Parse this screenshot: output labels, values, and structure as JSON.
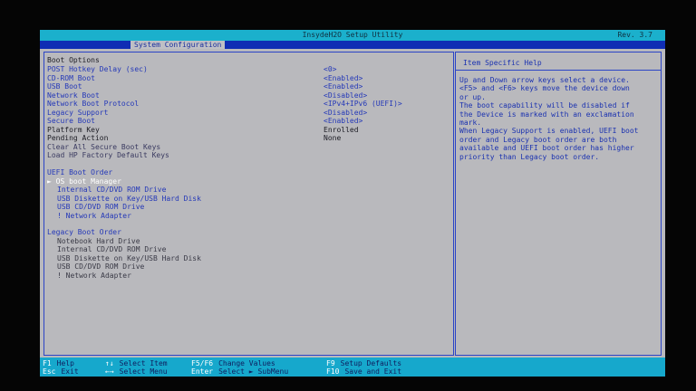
{
  "titlebar": {
    "title": "InsydeH2O Setup Utility",
    "rev": "Rev. 3.7"
  },
  "tab": "System Configuration",
  "settings": [
    {
      "label": "Boot Options",
      "value": "",
      "kind": "section"
    },
    {
      "label": "POST Hotkey Delay (sec)",
      "value": "<0>",
      "kind": "option"
    },
    {
      "label": "CD-ROM Boot",
      "value": "<Enabled>",
      "kind": "option"
    },
    {
      "label": "USB Boot",
      "value": "<Enabled>",
      "kind": "option"
    },
    {
      "label": "Network Boot",
      "value": "<Disabled>",
      "kind": "option"
    },
    {
      "label": "Network Boot Protocol",
      "value": "<IPv4+IPv6 (UEFI)>",
      "kind": "option"
    },
    {
      "label": "Legacy Support",
      "value": "<Disabled>",
      "kind": "option"
    },
    {
      "label": "Secure Boot",
      "value": "<Enabled>",
      "kind": "option"
    },
    {
      "label": "Platform Key",
      "value": "Enrolled",
      "kind": "fixed"
    },
    {
      "label": "Pending Action",
      "value": "None",
      "kind": "fixed"
    },
    {
      "label": "Clear All Secure Boot Keys",
      "value": "",
      "kind": "action"
    },
    {
      "label": "Load HP Factory Default Keys",
      "value": "",
      "kind": "action"
    }
  ],
  "uefi_order": {
    "heading": "UEFI Boot Order",
    "items": [
      "► OS boot Manager",
      "Internal CD/DVD ROM Drive",
      "USB Diskette on Key/USB Hard Disk",
      "USB CD/DVD ROM Drive",
      "! Network Adapter"
    ]
  },
  "legacy_order": {
    "heading": "Legacy Boot Order",
    "items": [
      "Notebook Hard Drive",
      "Internal CD/DVD ROM Drive",
      "USB Diskette on Key/USB Hard Disk",
      "USB CD/DVD ROM Drive",
      "! Network Adapter"
    ]
  },
  "help": {
    "title": "Item Specific Help",
    "lines": [
      "Up and Down arrow keys select a device.",
      "<F5> and <F6> keys move the device down",
      "or up.",
      "The boot capability will be disabled if",
      "the Device is marked with an exclamation",
      "mark.",
      "When Legacy Support is enabled, UEFI boot",
      "order and Legacy boot order are both",
      "available and UEFI boot order has higher",
      "priority than Legacy boot order."
    ]
  },
  "footer": [
    {
      "key": "F1",
      "desc": "Help"
    },
    {
      "key": "Esc",
      "desc": "Exit"
    },
    {
      "key": "↑↓",
      "desc": "Select Item"
    },
    {
      "key": "←→",
      "desc": "Select Menu"
    },
    {
      "key": "F5/F6",
      "desc": "Change Values"
    },
    {
      "key": "Enter",
      "desc": "Select ► SubMenu"
    },
    {
      "key": "F9",
      "desc": "Setup Defaults"
    },
    {
      "key": "F10",
      "desc": "Save and Exit"
    }
  ],
  "colors": {
    "title_bar": "#1bb0cc",
    "tab_bar": "#0f2db4",
    "panel_bg": "#b9b9bd",
    "option_text": "#2438b8",
    "selected_text": "#ffffff"
  }
}
